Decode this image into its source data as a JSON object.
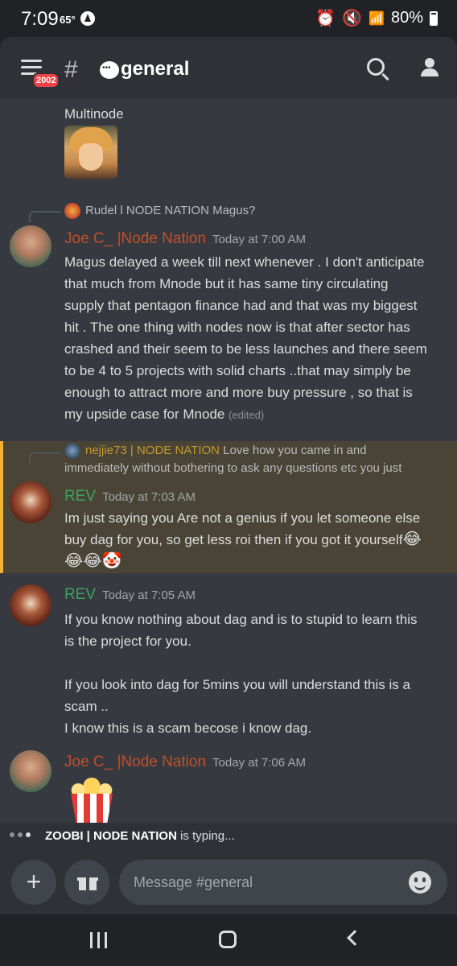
{
  "status_bar": {
    "time": "7:09",
    "temperature": "65°",
    "battery": "80%"
  },
  "header": {
    "notification_count": "2002",
    "channel_name": "general"
  },
  "messages": [
    {
      "id": "multinode",
      "text": "Multinode",
      "sticker": "anime-character"
    },
    {
      "id": "joe-1",
      "reply": {
        "author": "Rudel l NODE NATION",
        "preview": "Magus?"
      },
      "author": "Joe C_ |Node Nation",
      "timestamp": "Today at 7:00 AM",
      "lines": [
        "Magus delayed a week till next whenever . I don't anticipate",
        "that much from Mnode but it has same tiny circulating",
        "supply that pentagon finance had and that was my biggest",
        "hit .  The one thing with nodes now is that after sector has",
        "crashed and their seem to be less launches and there seem",
        "to be 4 to 5 projects with solid charts ..that may simply be",
        "enough to attract more and more buy pressure , so that is",
        "my upside case for Mnode"
      ],
      "edited": "(edited)"
    },
    {
      "id": "rev-1",
      "highlighted": true,
      "reply": {
        "author": "nejjie73 | NODE NATION",
        "preview": "Love how you came in and",
        "preview_line2": "immediately without bothering to ask any questions etc you just"
      },
      "author": "REV",
      "timestamp": "Today at 7:03 AM",
      "lines": [
        "Im just saying you Are not a genius if you let someone else",
        "buy dag for you, so get less roi then if you got it yourself"
      ],
      "emoji_inline": "😂",
      "emoji_line": "😂😂🤡"
    },
    {
      "id": "rev-2",
      "author": "REV",
      "timestamp": "Today at 7:05 AM",
      "lines": [
        "If you know nothing about dag and is to stupid to learn this",
        "is the project for you.",
        "",
        "If you look into dag for 5mins you will understand this is a",
        "scam ..",
        "I know this is a scam becose i know dag."
      ]
    },
    {
      "id": "joe-2",
      "author": "Joe C_ |Node Nation",
      "timestamp": "Today at 7:06 AM",
      "sticker": "popcorn"
    }
  ],
  "typing": {
    "user": "ZOOBI | NODE NATION",
    "suffix": "is typing..."
  },
  "composer": {
    "placeholder": "Message #general"
  },
  "colors": {
    "joe_name": "#c0502b",
    "rev_name": "#3ba55c",
    "highlight_bg": "#4a4436",
    "highlight_bar": "#f0b232",
    "badge": "#ed4245"
  }
}
